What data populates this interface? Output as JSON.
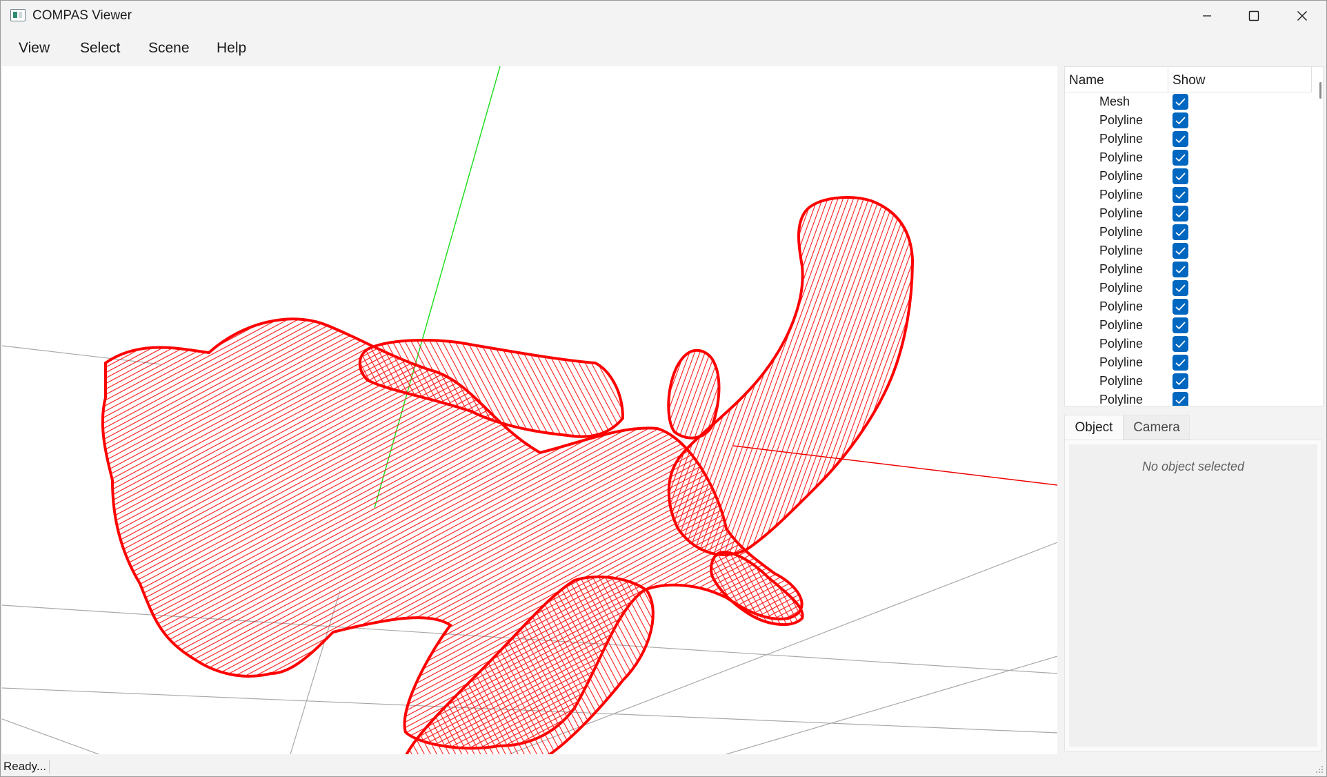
{
  "window": {
    "title": "COMPAS Viewer"
  },
  "menu": {
    "items": [
      "View",
      "Select",
      "Scene",
      "Help"
    ]
  },
  "scene_tree": {
    "columns": {
      "name": "Name",
      "show": "Show"
    },
    "rows": [
      {
        "name": "Mesh",
        "show": true
      },
      {
        "name": "Polyline",
        "show": true
      },
      {
        "name": "Polyline",
        "show": true
      },
      {
        "name": "Polyline",
        "show": true
      },
      {
        "name": "Polyline",
        "show": true
      },
      {
        "name": "Polyline",
        "show": true
      },
      {
        "name": "Polyline",
        "show": true
      },
      {
        "name": "Polyline",
        "show": true
      },
      {
        "name": "Polyline",
        "show": true
      },
      {
        "name": "Polyline",
        "show": true
      },
      {
        "name": "Polyline",
        "show": true
      },
      {
        "name": "Polyline",
        "show": true
      },
      {
        "name": "Polyline",
        "show": true
      },
      {
        "name": "Polyline",
        "show": true
      },
      {
        "name": "Polyline",
        "show": true
      },
      {
        "name": "Polyline",
        "show": true
      },
      {
        "name": "Polyline",
        "show": true
      }
    ]
  },
  "tabs": {
    "object": "Object",
    "camera": "Camera",
    "active": "Object"
  },
  "properties": {
    "empty_message": "No object selected"
  },
  "status": {
    "text": "Ready..."
  },
  "colors": {
    "mesh_contour": "#ff0000",
    "y_axis": "#00dd00",
    "x_axis": "#ee0000",
    "grid": "#a0a0a0",
    "checkbox": "#0067c0"
  }
}
